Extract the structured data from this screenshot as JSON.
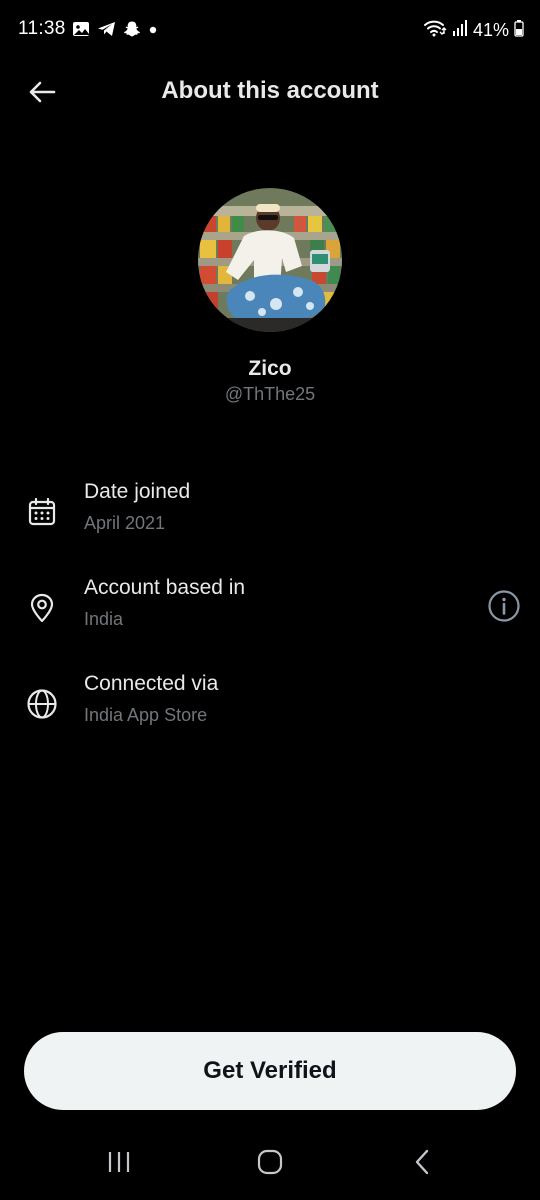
{
  "status_bar": {
    "time": "11:38",
    "battery": "41%",
    "left_icons": [
      "gallery-icon",
      "telegram-icon",
      "snapchat-icon",
      "notification-dot-icon"
    ],
    "right_icons": [
      "wifi-icon",
      "signal-icon",
      "battery-icon"
    ]
  },
  "header": {
    "title": "About this account",
    "back_icon": "arrow-left-icon"
  },
  "profile": {
    "name": "Zico",
    "handle": "@ThThe25"
  },
  "info_rows": [
    {
      "icon": "calendar-icon",
      "title": "Date joined",
      "value": "April 2021"
    },
    {
      "icon": "location-pin-icon",
      "title": "Account based in",
      "value": "India",
      "action_icon": "info-icon"
    },
    {
      "icon": "globe-icon",
      "title": "Connected via",
      "value": "India App Store"
    }
  ],
  "cta": {
    "label": "Get Verified"
  },
  "nav_bar": {
    "icons": [
      "recents-icon",
      "home-icon",
      "back-icon"
    ]
  },
  "colors": {
    "background": "#000000",
    "primary_text": "#e7e9ea",
    "secondary_text": "#71767b",
    "button_bg": "#eff3f4",
    "button_text": "#0f1419"
  }
}
